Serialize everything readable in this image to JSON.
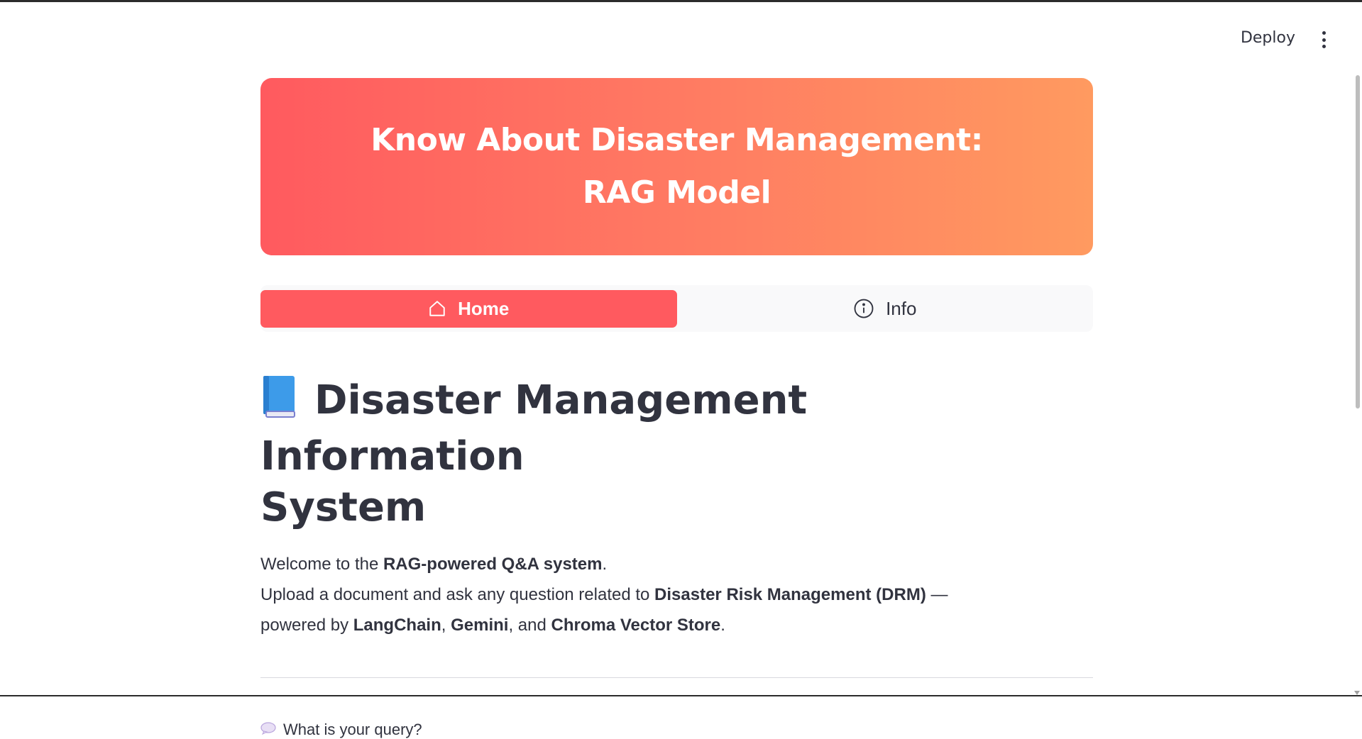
{
  "header": {
    "deploy_label": "Deploy",
    "menu_icon": "kebab-menu-icon"
  },
  "banner": {
    "line1": "Know About Disaster Management:",
    "line2": "RAG Model",
    "gradient_start": "#ff5a5f",
    "gradient_end": "#ff9a60"
  },
  "tabs": [
    {
      "label": "Home",
      "icon": "home-icon",
      "active": true
    },
    {
      "label": "Info",
      "icon": "info-icon",
      "active": false
    }
  ],
  "accent_color": "#ff5a5f",
  "content": {
    "title_line1": "Disaster Management Information",
    "title_line2": "System",
    "title_icon": "blue-book-icon",
    "welcome_prefix": "Welcome to the ",
    "welcome_bold": "RAG-powered Q&A system",
    "welcome_suffix": ".",
    "upload_prefix": "Upload a document and ask any question related to ",
    "upload_bold": "Disaster Risk Management (DRM)",
    "upload_suffix": " —",
    "powered_prefix": "powered by ",
    "powered_langchain": "LangChain",
    "powered_sep1": ", ",
    "powered_gemini": "Gemini",
    "powered_sep2": ", and ",
    "powered_chroma": "Chroma Vector Store",
    "powered_suffix": "."
  },
  "query": {
    "icon": "speech-bubble-icon",
    "label": "What is your query?"
  }
}
